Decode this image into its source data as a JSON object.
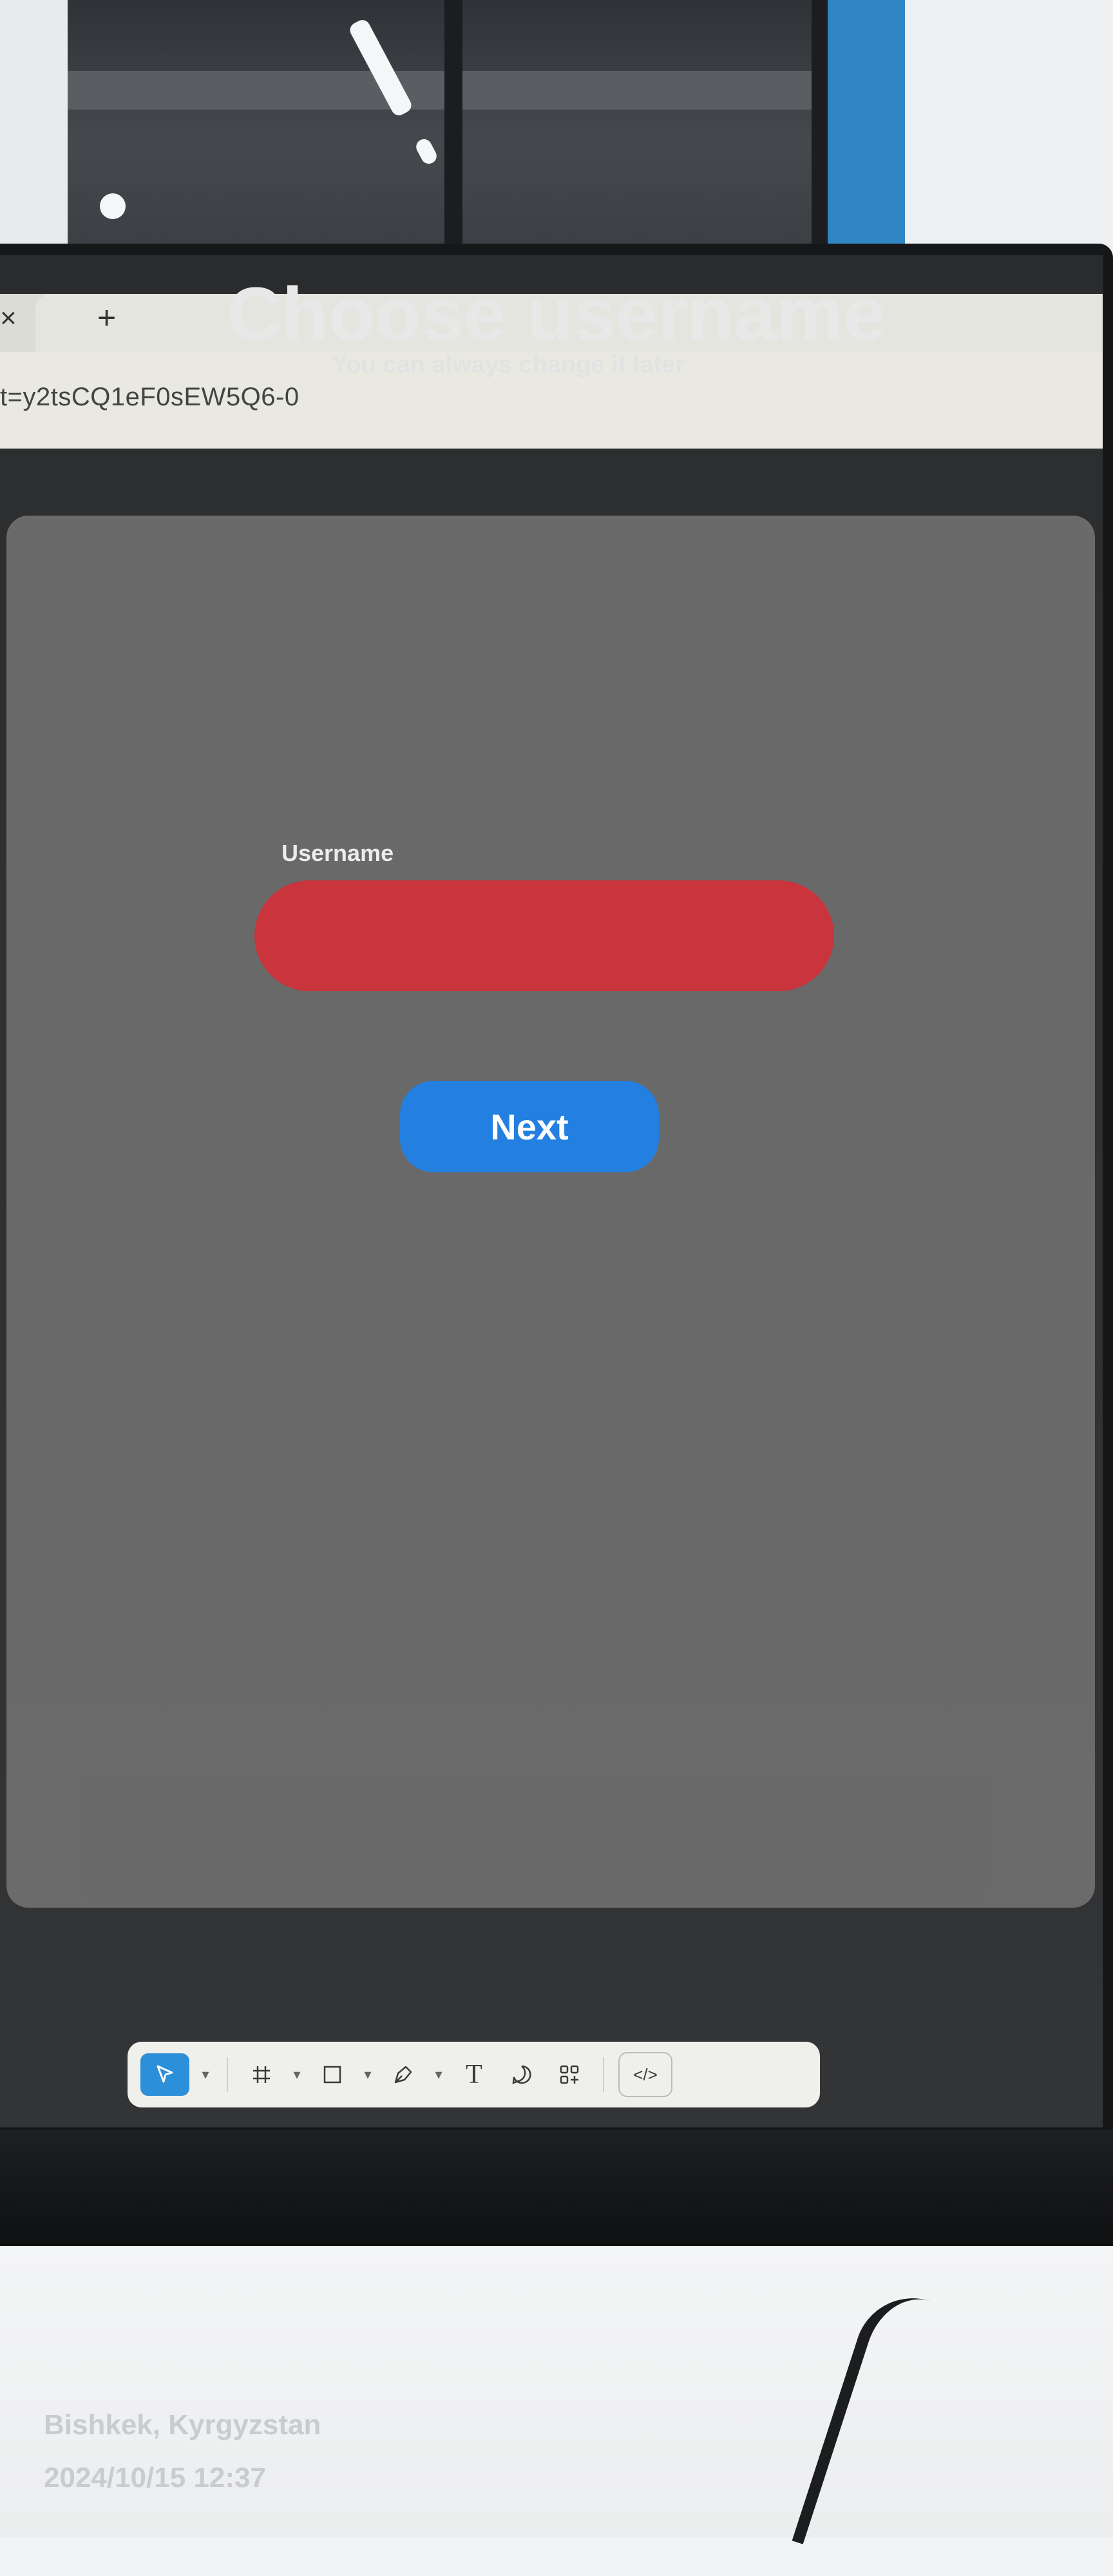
{
  "browser": {
    "close_glyph": "×",
    "new_tab_glyph": "+",
    "url_fragment": "t=y2tsCQ1eF0sEW5Q6-0"
  },
  "design": {
    "title": "Choose username",
    "subtitle": "You can always change it later",
    "field_label": "Username",
    "field_value": "",
    "next_label": "Next",
    "accent_color": "#2380e0",
    "error_color": "#c9343d"
  },
  "toolbar": {
    "tools": [
      {
        "name": "move-tool",
        "icon": "pointer-icon",
        "active": true
      },
      {
        "name": "frame-tool",
        "icon": "hash-icon",
        "active": false
      },
      {
        "name": "shape-tool",
        "icon": "rectangle-icon",
        "active": false
      },
      {
        "name": "pen-tool",
        "icon": "pen-icon",
        "active": false
      },
      {
        "name": "text-tool",
        "icon": "text-icon",
        "active": false
      },
      {
        "name": "comment-tool",
        "icon": "comment-icon",
        "active": false
      },
      {
        "name": "resources-tool",
        "icon": "resources-icon",
        "active": false
      },
      {
        "name": "dev-mode-tool",
        "icon": "code-icon",
        "active": false
      }
    ],
    "text_glyph": "T",
    "code_glyph": "</>"
  },
  "photo_overlay": {
    "location": "Bishkek, Kyrgyzstan",
    "timestamp": "2024/10/15 12:37"
  }
}
